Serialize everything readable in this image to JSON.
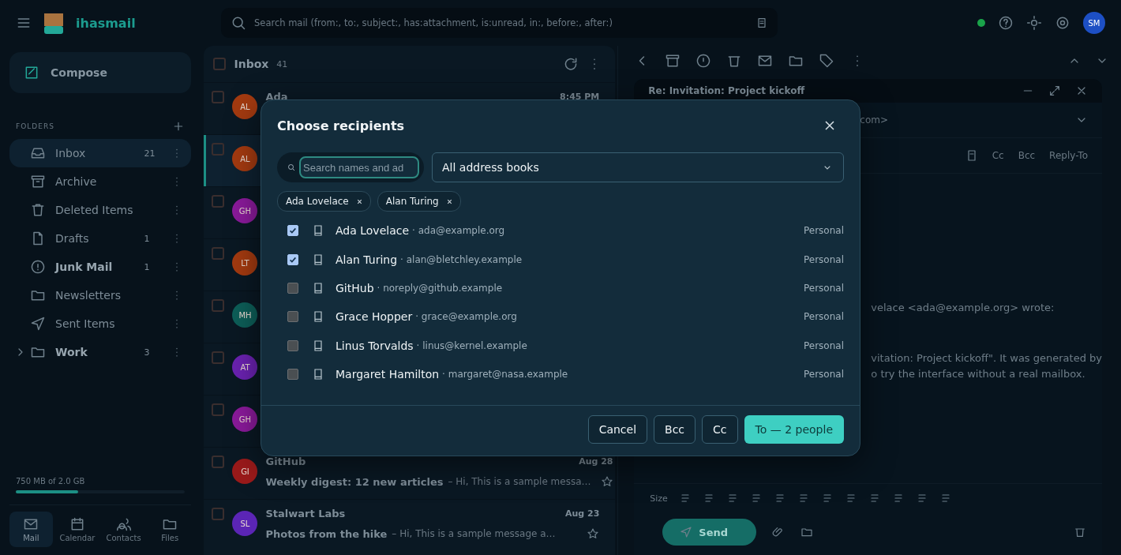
{
  "app": {
    "logo_text": "ihasmail",
    "search_placeholder": "Search mail (from:, to:, subject:, has:attachment, is:unread, in:, before:, after:)",
    "avatar": "SM"
  },
  "sidebar": {
    "compose": "Compose",
    "folders_heading": "FOLDERS",
    "folders": [
      {
        "name": "Inbox",
        "count": "21",
        "selected": true,
        "bold": false
      },
      {
        "name": "Archive",
        "selected": false,
        "bold": false
      },
      {
        "name": "Deleted Items",
        "selected": false,
        "bold": false
      },
      {
        "name": "Drafts",
        "count": "1",
        "selected": false,
        "bold": false
      },
      {
        "name": "Junk Mail",
        "count": "1",
        "selected": false,
        "bold": true
      },
      {
        "name": "Newsletters",
        "selected": false,
        "bold": false
      },
      {
        "name": "Sent Items",
        "selected": false,
        "bold": false
      },
      {
        "name": "Work",
        "count": "3",
        "selected": false,
        "bold": true,
        "expandable": true
      }
    ],
    "storage": {
      "text": "750 MB of 2.0 GB",
      "level": 0.37
    },
    "nav": [
      {
        "label": "Mail",
        "selected": true
      },
      {
        "label": "Calendar",
        "selected": false
      },
      {
        "label": "Contacts",
        "selected": false
      },
      {
        "label": "Files",
        "selected": false
      }
    ]
  },
  "message_list": {
    "title": "Inbox",
    "count": "41",
    "all_checked": false,
    "messages": [
      {
        "initials": "AL",
        "color": "#a33a10",
        "sender": "Ada",
        "time": "8:45 PM",
        "selected": false,
        "checked": false
      },
      {
        "initials": "AL",
        "color": "#a33a10",
        "selected": true,
        "checked": false
      },
      {
        "initials": "GH",
        "color": "#8a1a9a",
        "selected": false,
        "checked": false
      },
      {
        "initials": "LT",
        "color": "#a33a10",
        "selected": false,
        "checked": false
      },
      {
        "initials": "MH",
        "color": "#0d5e58",
        "selected": false,
        "checked": false
      },
      {
        "initials": "AT",
        "color": "#6a22b0",
        "selected": false,
        "checked": false
      },
      {
        "initials": "GH",
        "color": "#8a1a9a",
        "selected": false,
        "checked": false
      },
      {
        "initials": "GI",
        "color": "#9a1a1a",
        "sender": "GitHub",
        "time": "Aug 28",
        "subject": "Weekly digest: 12 new articles",
        "preview": "– Hi, This is a sample messa…",
        "selected": false,
        "checked": false
      },
      {
        "initials": "SL",
        "color": "#5b25b5",
        "sender": "Stalwart Labs",
        "time": "Aug 23",
        "subject": "Photos from the hike",
        "preview": "– Hi, This is a sample message a…",
        "selected": false,
        "checked": false
      }
    ]
  },
  "composer": {
    "title": "Re: Invitation: Project kickoff",
    "from_tail": "com>",
    "header_links": [
      "Cc",
      "Bcc",
      "Reply-To"
    ],
    "quote": "velace <ada@example.org> wrote:",
    "body": [
      "vitation: Project kickoff\". It was generated by",
      "o try the interface without a real mailbox."
    ],
    "size_label": "Size",
    "send": "Send"
  },
  "dialog": {
    "title": "Choose recipients",
    "search_placeholder": "Search names and ad",
    "address_book": "All address books",
    "chips": [
      "Ada Lovelace",
      "Alan Turing"
    ],
    "contacts": [
      {
        "name": "Ada Lovelace",
        "email": "· ada@example.org",
        "book": "Personal",
        "checked": true
      },
      {
        "name": "Alan Turing",
        "email": "· alan@bletchley.example",
        "book": "Personal",
        "checked": true
      },
      {
        "name": "GitHub",
        "email": "· noreply@github.example",
        "book": "Personal",
        "checked": false
      },
      {
        "name": "Grace Hopper",
        "email": "· grace@example.org",
        "book": "Personal",
        "checked": false
      },
      {
        "name": "Linus Torvalds",
        "email": "· linus@kernel.example",
        "book": "Personal",
        "checked": false
      },
      {
        "name": "Margaret Hamilton",
        "email": "· margaret@nasa.example",
        "book": "Personal",
        "checked": false
      }
    ],
    "buttons": [
      {
        "label": "Cancel",
        "kind": "secondary"
      },
      {
        "label": "Bcc",
        "kind": "secondary"
      },
      {
        "label": "Cc",
        "kind": "secondary"
      },
      {
        "label": "To — 2 people",
        "kind": "primary"
      }
    ]
  }
}
